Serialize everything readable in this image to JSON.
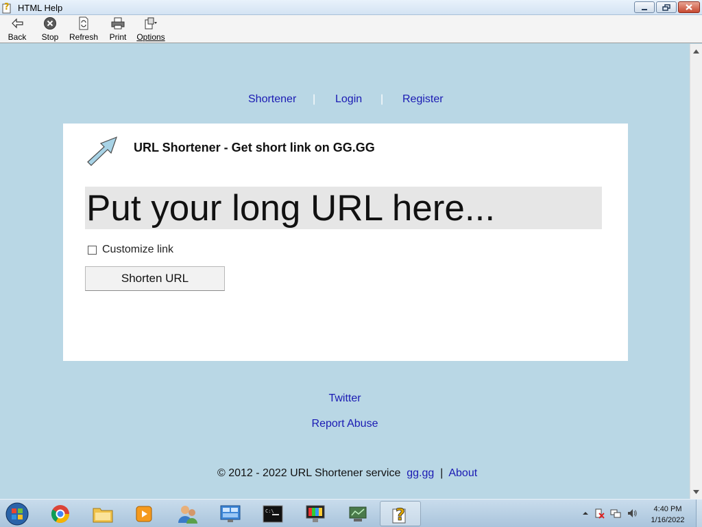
{
  "window": {
    "title": "HTML Help",
    "icon": "help-icon",
    "controls": [
      "minimize-icon",
      "maximize-icon",
      "close-icon"
    ]
  },
  "toolbar": {
    "back_label": "Back",
    "stop_label": "Stop",
    "refresh_label": "Refresh",
    "print_label": "Print",
    "options_label": "Options"
  },
  "nav": {
    "shortener": "Shortener",
    "sep1": "|",
    "login": "Login",
    "sep2": "|",
    "register": "Register"
  },
  "card": {
    "heading": "URL Shortener - Get short link on GG.GG",
    "input_placeholder": "Put your long URL here...",
    "customize_label": "Customize link",
    "customize_checked": false,
    "submit_label": "Shorten URL"
  },
  "footer": {
    "twitter": "Twitter",
    "report_abuse": "Report Abuse",
    "copyright": "© 2012 - 2022 URL Shortener service",
    "site_link": "gg.gg",
    "divider": "|",
    "about": "About"
  },
  "taskbar": {
    "items": [
      "start-orb-icon",
      "chrome-icon",
      "file-explorer-icon",
      "media-player-icon",
      "user-accounts-icon",
      "control-panel-icon",
      "command-prompt-icon",
      "display-icon",
      "network-icon",
      "html-help-icon"
    ],
    "active_item": "html-help-icon",
    "time": "4:40 PM",
    "date": "1/16/2022"
  },
  "colors": {
    "page_background": "#b9d7e5",
    "link": "#1a1ab3",
    "input_background": "#e6e6e6"
  }
}
